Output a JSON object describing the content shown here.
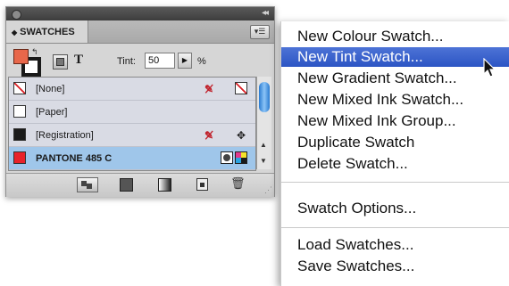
{
  "panel": {
    "tab_label": "SWATCHES",
    "tab_arrows": "◆",
    "collapse_glyph": "◂◂",
    "menu_glyph": "▾☰",
    "tint_label": "Tint:",
    "tint_value": "50",
    "tint_unit": "%",
    "text_toggle": "T",
    "swatches": [
      {
        "name": "[None]",
        "chip_color": "#ffffff",
        "type": "none"
      },
      {
        "name": "[Paper]",
        "chip_color": "#ffffff",
        "type": "paper"
      },
      {
        "name": "[Registration]",
        "chip_color": "#1a1a1a",
        "type": "registration"
      },
      {
        "name": "PANTONE 485 C",
        "chip_color": "#e8222a",
        "type": "spot",
        "selected": true
      }
    ],
    "icons": {
      "no_edit": "pencil-crossed-icon",
      "registration_mark": "✥"
    },
    "fill_color": "#e8674a"
  },
  "menu": {
    "items": [
      {
        "label": "New Colour Swatch..."
      },
      {
        "label": "New Tint Swatch...",
        "highlighted": true
      },
      {
        "label": "New Gradient Swatch..."
      },
      {
        "label": "New Mixed Ink Swatch..."
      },
      {
        "label": "New Mixed Ink Group..."
      },
      {
        "label": "Duplicate Swatch"
      },
      {
        "label": "Delete Swatch..."
      },
      {
        "label": "Swatch Options..."
      },
      {
        "label": "Load Swatches..."
      },
      {
        "label": "Save Swatches..."
      }
    ],
    "highlight_color": "#2f5bd0"
  }
}
